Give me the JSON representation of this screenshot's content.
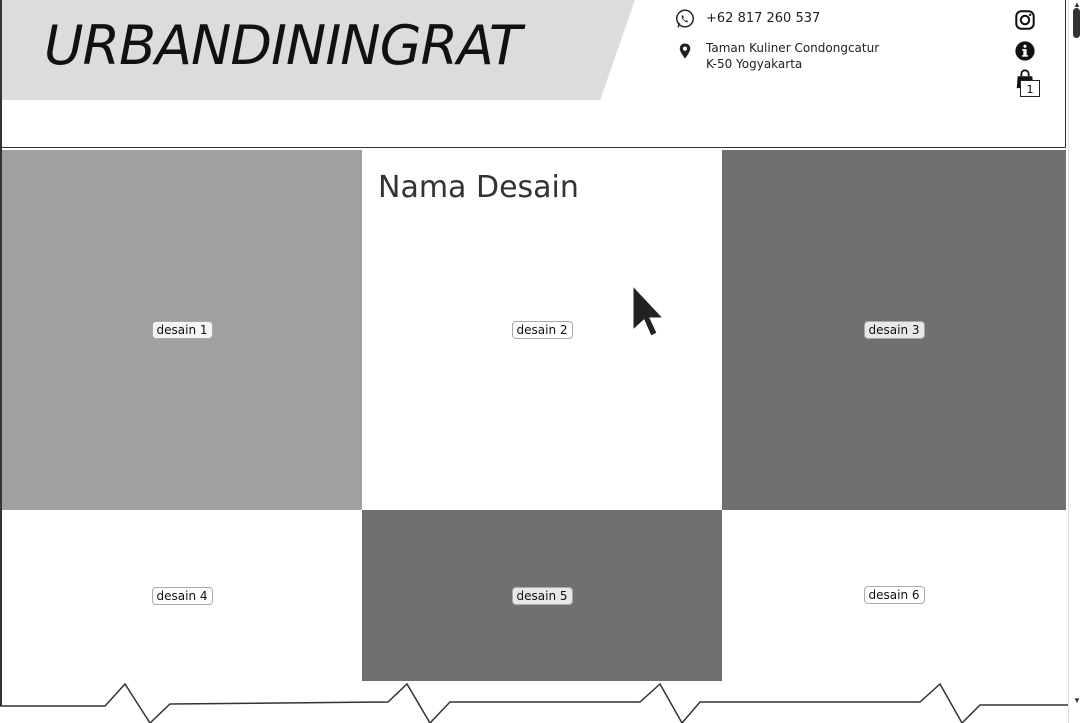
{
  "header": {
    "logo": "URBANDININGRAT",
    "phone": "+62 817 260 537",
    "address_line1": "Taman Kuliner Condongcatur",
    "address_line2": "K-50 Yogyakarta",
    "cart_count": "1",
    "icons": [
      "whatsapp-icon",
      "location-pin-icon",
      "instagram-icon",
      "info-icon",
      "shopping-bag-icon"
    ]
  },
  "main": {
    "title": "Nama Desain",
    "tiles": [
      {
        "label": "desain 1",
        "color": "#a0a0a0"
      },
      {
        "label": "desain 2",
        "color": "#ffffff"
      },
      {
        "label": "desain 3",
        "color": "#707070"
      },
      {
        "label": "desain 4",
        "color": "#ffffff"
      },
      {
        "label": "desain 5",
        "color": "#707070"
      },
      {
        "label": "desain 6",
        "color": "#ffffff"
      }
    ]
  }
}
